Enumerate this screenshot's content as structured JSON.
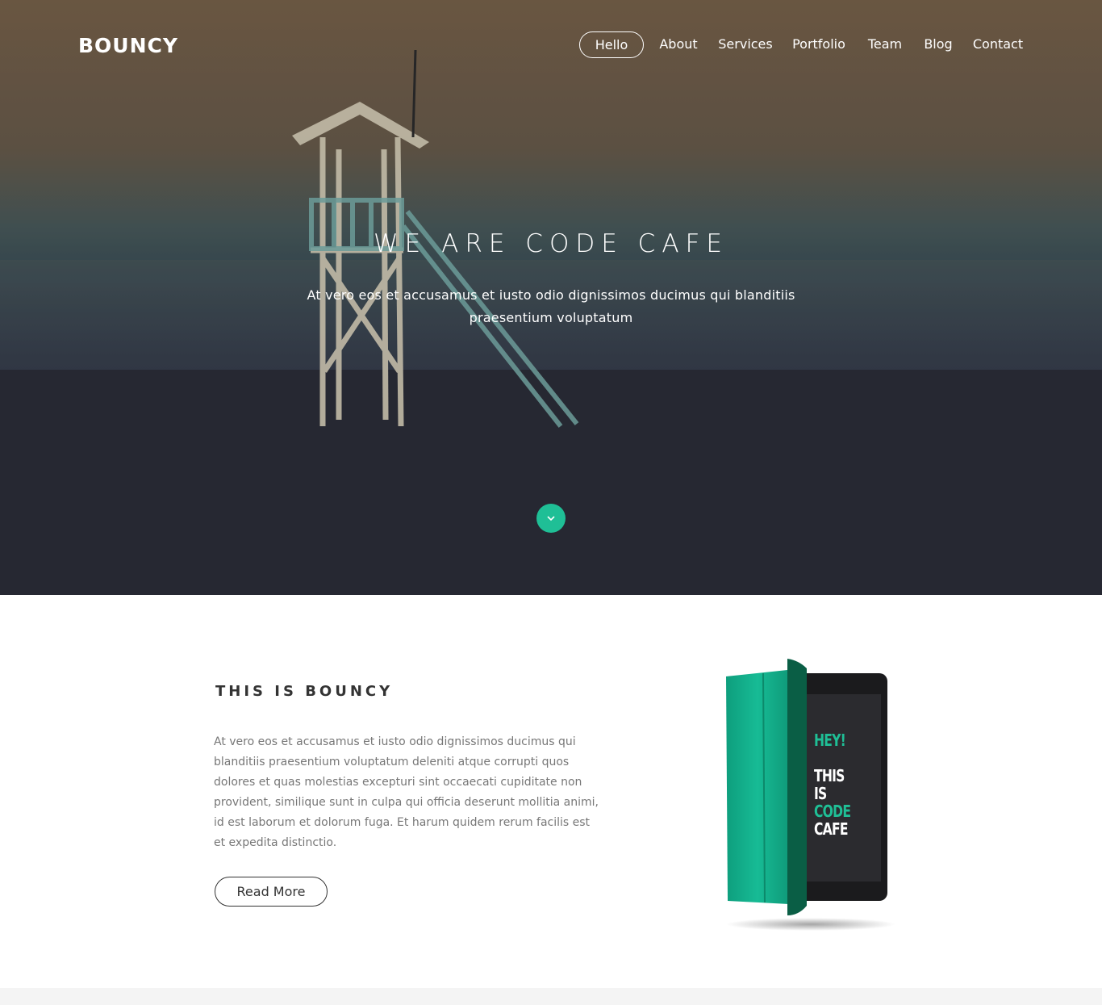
{
  "brand": {
    "name": "BOUNCY"
  },
  "nav": {
    "items": [
      {
        "label": "Hello",
        "active": true
      },
      {
        "label": "About",
        "active": false
      },
      {
        "label": "Services",
        "active": false
      },
      {
        "label": "Portfolio",
        "active": false
      },
      {
        "label": "Team",
        "active": false
      },
      {
        "label": "Blog",
        "active": false
      },
      {
        "label": "Contact",
        "active": false
      }
    ]
  },
  "hero": {
    "title": "WE ARE CODE CAFE",
    "subtitle": "At vero eos et accusamus et iusto odio dignissimos ducimus qui blanditiis praesentium voluptatum",
    "scroll_icon": "chevron-down-icon",
    "scroll_color": "#1fbf96"
  },
  "about": {
    "title": "THIS IS BOUNCY",
    "text": "At vero eos et accusamus et iusto odio dignissimos ducimus qui blanditiis praesentium voluptatum deleniti atque corrupti quos dolores et quas molestias excepturi sint occaecati cupiditate non provident, similique sunt in culpa qui officia deserunt mollitia animi, id est laborum et dolorum fuga. Et harum quidem rerum facilis est et expedita distinctio.",
    "button_label": "Read More"
  },
  "device": {
    "screen_lines": [
      {
        "text": "HEY!",
        "color": "#1fbf96"
      },
      {
        "text": "THIS",
        "color": "#ffffff"
      },
      {
        "text": "IS",
        "color": "#ffffff"
      },
      {
        "text": "CODE",
        "color": "#1fbf96"
      },
      {
        "text": "CAFE",
        "color": "#ffffff"
      }
    ],
    "cover_color": "#14b38f"
  },
  "colors": {
    "accent": "#1fbf96",
    "text_dark": "#333333",
    "text_muted": "#777777"
  }
}
